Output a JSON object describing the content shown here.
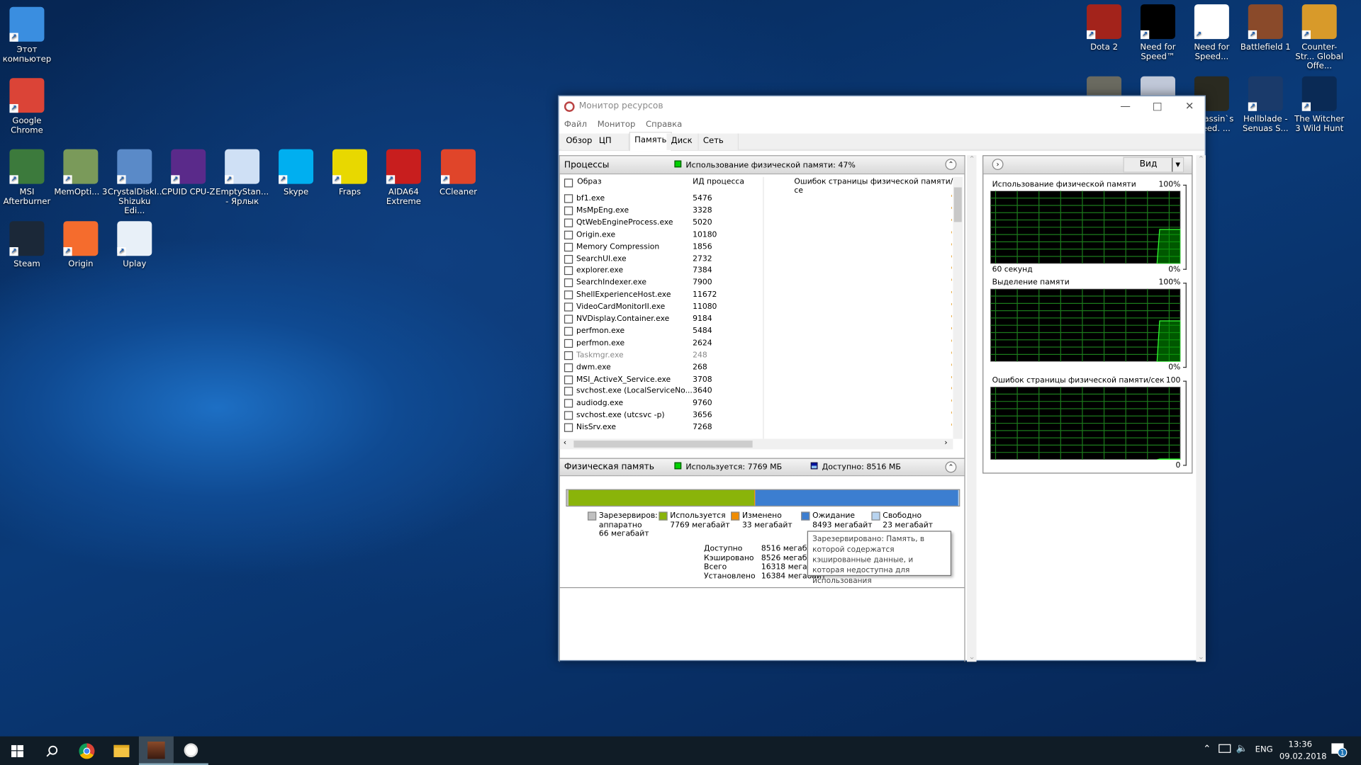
{
  "desktop": {
    "left_icons": [
      {
        "label": "Этот компьютер",
        "icon": "computer-icon",
        "color": "#3a8ee0"
      },
      {
        "label": "Google Chrome",
        "icon": "chrome-icon",
        "color": "#db4437"
      },
      {
        "label": "MSI Afterburner",
        "icon": "msi-afterburner-icon",
        "color": "#3c7a3c"
      },
      {
        "label": "MemOpti... 3",
        "icon": "memoptimizer-icon",
        "color": "#7a9a5a"
      },
      {
        "label": "CrystalDiskI... Shizuku Edi...",
        "icon": "crystaldiskinfo-icon",
        "color": "#5a8ac8"
      },
      {
        "label": "CPUID CPU-Z",
        "icon": "cpuz-icon",
        "color": "#5a2a8a"
      },
      {
        "label": "EmptyStan... - Ярлык",
        "icon": "emptystandby-icon",
        "color": "#cfe0f5"
      },
      {
        "label": "Skype",
        "icon": "skype-icon",
        "color": "#00aff0"
      },
      {
        "label": "Fraps",
        "icon": "fraps-icon",
        "color": "#e8d800"
      },
      {
        "label": "AIDA64 Extreme",
        "icon": "aida64-icon",
        "color": "#c81e1e"
      },
      {
        "label": "CCleaner",
        "icon": "ccleaner-icon",
        "color": "#e0452a"
      },
      {
        "label": "Steam",
        "icon": "steam-icon",
        "color": "#1b2838"
      },
      {
        "label": "Origin",
        "icon": "origin-icon",
        "color": "#f56c2d"
      },
      {
        "label": "Uplay",
        "icon": "uplay-icon",
        "color": "#e8f0f8"
      }
    ],
    "right_icons": [
      {
        "label": "Dota 2",
        "icon": "dota2-icon",
        "color": "#a3231b"
      },
      {
        "label": "Need for Speed™",
        "icon": "nfs-icon",
        "color": "#000000"
      },
      {
        "label": "Need for Speed...",
        "icon": "nfs-payback-icon",
        "color": "#ffffff"
      },
      {
        "label": "Battlefield 1",
        "icon": "battlefield1-icon",
        "color": "#8a4a2a"
      },
      {
        "label": "Counter-Str... Global Offe...",
        "icon": "csgo-icon",
        "color": "#d89a2a"
      },
      {
        "label": "",
        "icon": "game-icon",
        "color": "#6a6a60"
      },
      {
        "label": "",
        "icon": "game-icon",
        "color": "#c0c8d8"
      },
      {
        "label": "Assassin`s Creed. ...",
        "icon": "assassins-creed-icon",
        "color": "#2a2a20"
      },
      {
        "label": "Hellblade - Senuas S...",
        "icon": "hellblade-icon",
        "color": "#1a3a6a"
      },
      {
        "label": "The Witcher 3 Wild Hunt",
        "icon": "witcher-icon",
        "color": "#0a2a55"
      }
    ]
  },
  "window": {
    "title": "Монитор ресурсов",
    "menu": [
      "Файл",
      "Монитор",
      "Справка"
    ],
    "tabs": [
      "Обзор",
      "ЦП",
      "Память",
      "Диск",
      "Сеть"
    ],
    "active_tab": "Память",
    "processes": {
      "title": "Процессы",
      "status": "Использование физической памяти: 47%",
      "columns": [
        "Образ",
        "ИД процесса",
        "Ошибок страницы физической памяти/се"
      ],
      "rows": [
        {
          "name": "bf1.exe",
          "pid": "5476"
        },
        {
          "name": "MsMpEng.exe",
          "pid": "3328"
        },
        {
          "name": "QtWebEngineProcess.exe",
          "pid": "5020"
        },
        {
          "name": "Origin.exe",
          "pid": "10180"
        },
        {
          "name": "Memory Compression",
          "pid": "1856"
        },
        {
          "name": "SearchUI.exe",
          "pid": "2732"
        },
        {
          "name": "explorer.exe",
          "pid": "7384"
        },
        {
          "name": "SearchIndexer.exe",
          "pid": "7900"
        },
        {
          "name": "ShellExperienceHost.exe",
          "pid": "11672"
        },
        {
          "name": "VideoCardMonitorII.exe",
          "pid": "11080"
        },
        {
          "name": "NVDisplay.Container.exe",
          "pid": "9184"
        },
        {
          "name": "perfmon.exe",
          "pid": "5484"
        },
        {
          "name": "perfmon.exe",
          "pid": "2624"
        },
        {
          "name": "Taskmgr.exe",
          "pid": "248",
          "dimmed": true
        },
        {
          "name": "dwm.exe",
          "pid": "268"
        },
        {
          "name": "MSI_ActiveX_Service.exe",
          "pid": "3708"
        },
        {
          "name": "svchost.exe (LocalServiceNo...",
          "pid": "3640"
        },
        {
          "name": "audiodg.exe",
          "pid": "9760"
        },
        {
          "name": "svchost.exe (utcsvc -p)",
          "pid": "3656"
        },
        {
          "name": "NisSrv.exe",
          "pid": "7268"
        }
      ]
    },
    "physical_memory": {
      "title": "Физическая память",
      "used": "Используется: 7769 МБ",
      "available": "Доступно: 8516 МБ",
      "bar": {
        "reserved_mb": 66,
        "used_mb": 7769,
        "modified_mb": 33,
        "standby_mb": 8493,
        "free_mb": 23
      },
      "legend": [
        {
          "label": "Зарезервиров:",
          "line2": "аппаратно",
          "line3": "66 мегабайт",
          "color": "#c0c0c0"
        },
        {
          "label": "Используется",
          "line2": "7769 мегабайт",
          "color": "#8ab40a"
        },
        {
          "label": "Изменено",
          "line2": "33 мегабайт",
          "color": "#f08c00"
        },
        {
          "label": "Ожидание",
          "line2": "8493 мегабайт",
          "color": "#3c7ed0"
        },
        {
          "label": "Свободно",
          "line2": "23 мегабайт",
          "color": "#b8d4f0"
        }
      ],
      "stats": [
        {
          "label": "Доступно",
          "value": "8516 мегаб"
        },
        {
          "label": "Кэшировано",
          "value": "8526 мегаб"
        },
        {
          "label": "Всего",
          "value": "16318 мегаб"
        },
        {
          "label": "Установлено",
          "value": "16384 мегабайт"
        }
      ],
      "tooltip": "Зарезервировано: Память, в которой содержатся кэшированные данные, и которая недоступна для использования"
    },
    "graphs": {
      "view_label": "Вид",
      "items": [
        {
          "title": "Использование физической памяти",
          "max": "100%",
          "min": "0%",
          "footer_left": "60 секунд",
          "current_percent": 47
        },
        {
          "title": "Выделение памяти",
          "max": "100%",
          "min": "0%",
          "footer_left": "",
          "current_percent": 56
        },
        {
          "title": "Ошибок страницы физической памяти/сек",
          "max": "100",
          "min": "0",
          "footer_left": "",
          "current_percent": 1
        }
      ]
    }
  },
  "taskbar": {
    "language": "ENG",
    "time": "13:36",
    "date": "09.02.2018",
    "notifications": "1"
  }
}
